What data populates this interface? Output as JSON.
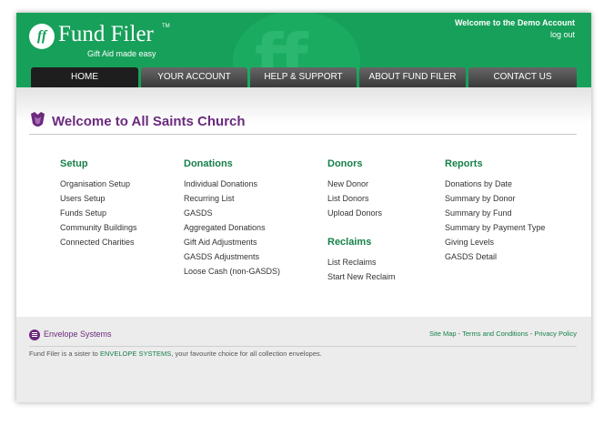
{
  "header": {
    "logo_name": "Fund Filer",
    "logo_mark": "ff",
    "logo_tm": "TM",
    "tagline": "Gift Aid made easy",
    "welcome": "Welcome to the Demo Account",
    "logout": "log out",
    "bg_mark": "ff"
  },
  "nav": {
    "tabs": [
      {
        "label": "HOME",
        "active": true
      },
      {
        "label": "YOUR ACCOUNT",
        "active": false
      },
      {
        "label": "HELP & SUPPORT",
        "active": false
      },
      {
        "label": "ABOUT FUND FILER",
        "active": false
      },
      {
        "label": "CONTACT US",
        "active": false
      }
    ]
  },
  "main": {
    "title": "Welcome to All Saints Church",
    "title_icon": "church-badge-icon",
    "setup": {
      "heading": "Setup",
      "links": [
        "Organisation Setup",
        "Users Setup",
        "Funds Setup",
        "Community Buildings",
        "Connected Charities"
      ]
    },
    "donations": {
      "heading": "Donations",
      "links": [
        "Individual Donations",
        "Recurring List",
        "GASDS",
        "Aggregated Donations",
        "Gift Aid Adjustments",
        "GASDS Adjustments",
        "Loose Cash (non-GASDS)"
      ]
    },
    "donors": {
      "heading": "Donors",
      "links": [
        "New Donor",
        "List Donors",
        "Upload Donors"
      ]
    },
    "reclaims": {
      "heading": "Reclaims",
      "links": [
        "List Reclaims",
        "Start New Reclaim"
      ]
    },
    "reports": {
      "heading": "Reports",
      "links": [
        "Donations by Date",
        "Summary by Donor",
        "Summary by Fund",
        "Summary by Payment Type",
        "Giving Levels",
        "GASDS Detail"
      ]
    }
  },
  "footer": {
    "brand": "Envelope Systems",
    "brand_icon": "envelope-systems-icon",
    "links": [
      "Site Map",
      "Terms and Conditions",
      "Privacy Policy"
    ],
    "separator": " - ",
    "text_before": "Fund Filer is a sister to ",
    "text_link": "ENVELOPE SYSTEMS",
    "text_after": ", your favourite choice for all collection envelopes."
  },
  "colors": {
    "brand_green": "#17a05a",
    "title_purple": "#6b2a7d",
    "heading_green": "#17804a"
  }
}
